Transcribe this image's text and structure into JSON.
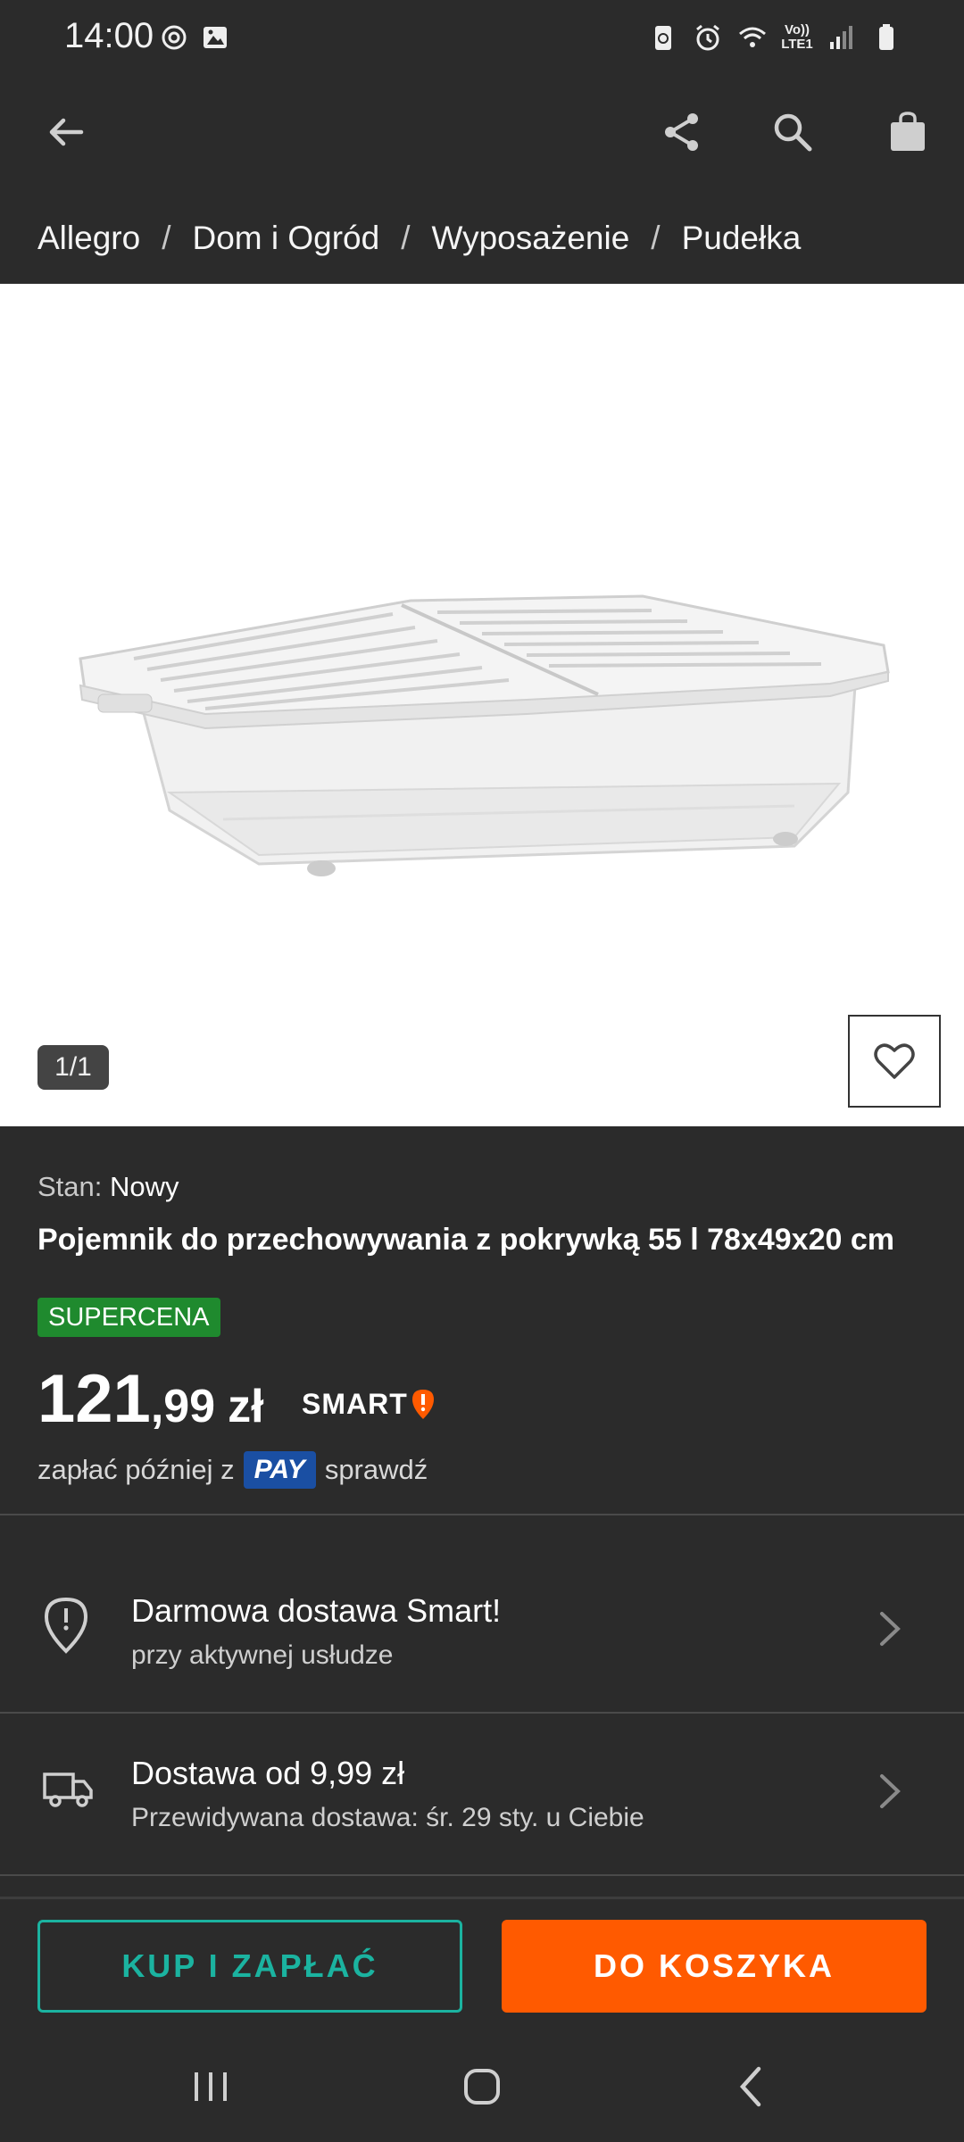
{
  "status_bar": {
    "time": "14:00",
    "network": "Vo)) LTE1"
  },
  "icons": {
    "back": "arrow-left-icon",
    "share": "share-icon",
    "search": "search-icon",
    "cart": "shopping-bag-icon",
    "favorite": "heart-icon",
    "smart_location": "location-pin-icon",
    "delivery": "truck-icon",
    "chevron": "chevron-right-icon"
  },
  "breadcrumb": {
    "items": [
      "Allegro",
      "Dom i Ogród",
      "Wyposażenie",
      "Pudełka"
    ],
    "separator": "/"
  },
  "gallery": {
    "counter": "1/1"
  },
  "product": {
    "condition_label": "Stan:",
    "condition_value": "Nowy",
    "title": "Pojemnik do przechowywania z pokrywką 55 l 78x49x20 cm",
    "badge": "SUPERCENA",
    "price_int": "121",
    "price_dec": ",99",
    "currency": "zł",
    "smart_label": "SMART",
    "pay_later_text": "zapłać później z",
    "pay_brand": "PAY",
    "pay_check": "sprawdź"
  },
  "delivery": [
    {
      "title": "Darmowa dostawa Smart!",
      "subtitle": "przy aktywnej usłudze"
    },
    {
      "title": "Dostawa od 9,99 zł",
      "subtitle": "Przewidywana dostawa: śr. 29 sty. u Ciebie"
    }
  ],
  "actions": {
    "buy_now": "KUP I ZAPŁAĆ",
    "add_to_cart": "DO KOSZYKA"
  },
  "colors": {
    "background": "#2b2b2b",
    "accent_orange": "#ff5a00",
    "accent_teal": "#1bb3a0",
    "badge_green": "#1f8a2e",
    "pay_blue": "#1a4fa3"
  }
}
